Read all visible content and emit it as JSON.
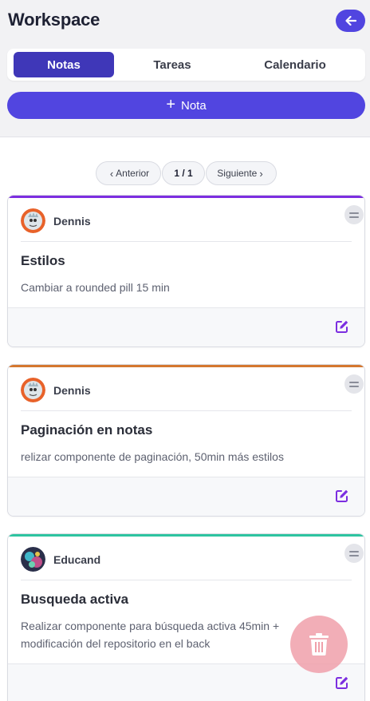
{
  "app": {
    "title": "Workspace"
  },
  "header": {
    "back_icon": "arrow-left-icon",
    "accent": "#5145e0"
  },
  "tabs": [
    {
      "label": "Notas",
      "active": true
    },
    {
      "label": "Tareas",
      "active": false
    },
    {
      "label": "Calendario",
      "active": false
    }
  ],
  "add_note": {
    "label": "Nota",
    "icon": "plus-icon"
  },
  "pagination": {
    "prev_label": "Anterior",
    "current": "1 / 1",
    "next_label": "Siguiente"
  },
  "notes": [
    {
      "author": "Dennis",
      "title": "Estilos",
      "description": "Cambiar a rounded pill 15 min",
      "accent": "#7c2ee0"
    },
    {
      "author": "Dennis",
      "title": "Paginación en notas",
      "description": "relizar componente de paginación, 50min más estilos",
      "accent": "#d4772f"
    },
    {
      "author": "Educand",
      "title": "Busqueda activa",
      "description": "Realizar componente para búsqueda activa 45min + modificación del repositorio en el back",
      "accent": "#2ec4a0"
    }
  ],
  "fab": {
    "icon": "trash-icon",
    "color": "#f0a0aa"
  }
}
